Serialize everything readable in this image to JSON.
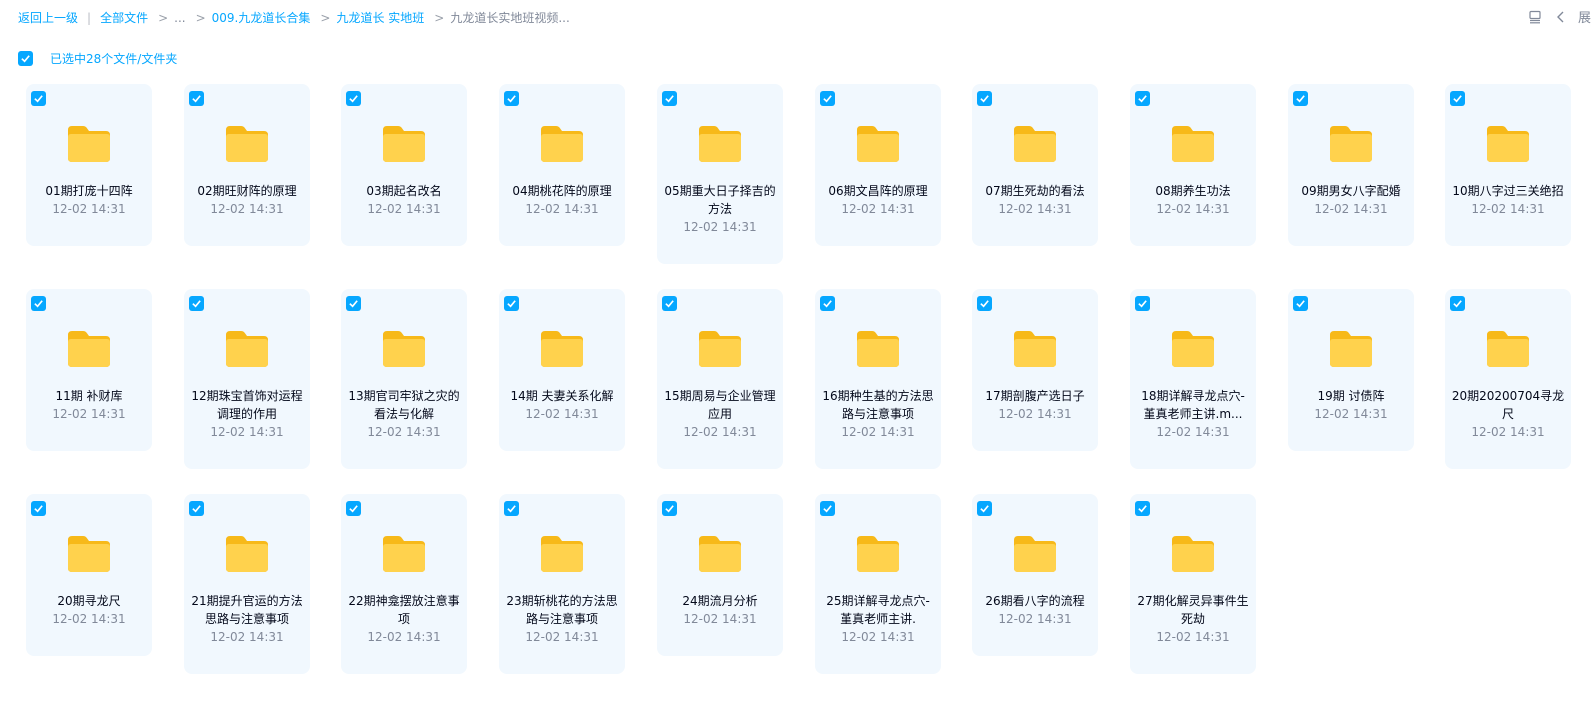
{
  "breadcrumb": {
    "back_label": "返回上一级",
    "root_label": "全部文件",
    "ellipsis": "...",
    "path_1": "009.九龙道长合集",
    "path_2": "九龙道长 实地班",
    "current": "九龙道长实地班视频...",
    "gt": ">",
    "bar": "|"
  },
  "toolbar": {
    "layout_icon": "list-view-icon",
    "collapse_icon": "chevron-left-icon",
    "expand_label": "展"
  },
  "selection": {
    "label": "已选中28个文件/文件夹",
    "checked": true
  },
  "colors": {
    "accent": "#06a7ff",
    "card_bg": "#f1f8fe",
    "folder_back": "#f7b919",
    "folder_front": "#ffd24d"
  },
  "files": [
    {
      "name": "01期打庞十四阵",
      "time": "12-02 14:31"
    },
    {
      "name": "02期旺财阵的原理",
      "time": "12-02 14:31"
    },
    {
      "name": "03期起名改名",
      "time": "12-02 14:31"
    },
    {
      "name": "04期桃花阵的原理",
      "time": "12-02 14:31"
    },
    {
      "name": "05期重大日子择吉的方法",
      "time": "12-02 14:31"
    },
    {
      "name": "06期文昌阵的原理",
      "time": "12-02 14:31"
    },
    {
      "name": "07期生死劫的看法",
      "time": "12-02 14:31"
    },
    {
      "name": "08期养生功法",
      "time": "12-02 14:31"
    },
    {
      "name": "09期男女八字配婚",
      "time": "12-02 14:31"
    },
    {
      "name": "10期八字过三关绝招",
      "time": "12-02 14:31"
    },
    {
      "name": "11期 补财库",
      "time": "12-02 14:31"
    },
    {
      "name": "12期珠宝首饰对运程调理的作用",
      "time": "12-02 14:31"
    },
    {
      "name": "13期官司牢狱之灾的看法与化解",
      "time": "12-02 14:31"
    },
    {
      "name": "14期 夫妻关系化解",
      "time": "12-02 14:31"
    },
    {
      "name": "15期周易与企业管理应用",
      "time": "12-02 14:31"
    },
    {
      "name": "16期种生基的方法思路与注意事项",
      "time": "12-02 14:31"
    },
    {
      "name": "17期剖腹产选日子",
      "time": "12-02 14:31"
    },
    {
      "name": "18期详解寻龙点穴-堇真老师主讲.m...",
      "time": "12-02 14:31"
    },
    {
      "name": "19期 讨债阵",
      "time": "12-02 14:31"
    },
    {
      "name": "20期20200704寻龙尺",
      "time": "12-02 14:31"
    },
    {
      "name": "20期寻龙尺",
      "time": "12-02 14:31"
    },
    {
      "name": "21期提升官运的方法思路与注意事项",
      "time": "12-02 14:31"
    },
    {
      "name": "22期神龛摆放注意事项",
      "time": "12-02 14:31"
    },
    {
      "name": "23期斩桃花的方法思路与注意事项",
      "time": "12-02 14:31"
    },
    {
      "name": "24期流月分析",
      "time": "12-02 14:31"
    },
    {
      "name": "25期详解寻龙点穴-堇真老师主讲.",
      "time": "12-02 14:31"
    },
    {
      "name": "26期看八字的流程",
      "time": "12-02 14:31"
    },
    {
      "name": "27期化解灵异事件生死劫",
      "time": "12-02 14:31"
    }
  ]
}
